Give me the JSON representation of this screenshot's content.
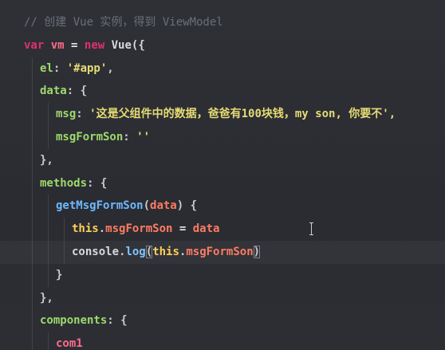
{
  "editor": {
    "lines": [
      {
        "indent": 0,
        "tokens": [
          {
            "t": "// 创建 Vue 实例，得到 ViewModel",
            "c": "comment"
          }
        ]
      },
      {
        "indent": 0,
        "tokens": [
          {
            "t": "var",
            "c": "keyword"
          },
          {
            "t": " ",
            "c": "plain"
          },
          {
            "t": "vm",
            "c": "var"
          },
          {
            "t": " = ",
            "c": "op"
          },
          {
            "t": "new",
            "c": "keyword"
          },
          {
            "t": " Vue({",
            "c": "plain"
          }
        ]
      },
      {
        "indent": 1,
        "tokens": [
          {
            "t": "el",
            "c": "prop"
          },
          {
            "t": ": ",
            "c": "punct"
          },
          {
            "t": "'#app'",
            "c": "string"
          },
          {
            "t": ",",
            "c": "punct"
          }
        ]
      },
      {
        "indent": 1,
        "tokens": [
          {
            "t": "data",
            "c": "prop"
          },
          {
            "t": ": {",
            "c": "punct"
          }
        ]
      },
      {
        "indent": 2,
        "tokens": [
          {
            "t": "msg",
            "c": "prop"
          },
          {
            "t": ": ",
            "c": "punct"
          },
          {
            "t": "'这是父组件中的数据，爸爸有100块钱，my son, 你要不',",
            "c": "string"
          }
        ]
      },
      {
        "indent": 2,
        "tokens": [
          {
            "t": "msgFormSon",
            "c": "prop"
          },
          {
            "t": ": ",
            "c": "punct"
          },
          {
            "t": "''",
            "c": "string"
          }
        ]
      },
      {
        "indent": 1,
        "tokens": [
          {
            "t": "},",
            "c": "punct"
          }
        ]
      },
      {
        "indent": 1,
        "tokens": [
          {
            "t": "methods",
            "c": "prop"
          },
          {
            "t": ": {",
            "c": "punct"
          }
        ]
      },
      {
        "indent": 2,
        "tokens": [
          {
            "t": "getMsgFormSon",
            "c": "fn"
          },
          {
            "t": "(",
            "c": "punct"
          },
          {
            "t": "data",
            "c": "param"
          },
          {
            "t": ") {",
            "c": "punct"
          }
        ]
      },
      {
        "indent": 3,
        "tokens": [
          {
            "t": "this",
            "c": "this"
          },
          {
            "t": ".",
            "c": "punct"
          },
          {
            "t": "msgFormSon",
            "c": "member"
          },
          {
            "t": " = ",
            "c": "op"
          },
          {
            "t": "data",
            "c": "param"
          }
        ]
      },
      {
        "indent": 3,
        "current": true,
        "tokens": [
          {
            "t": "console",
            "c": "plain"
          },
          {
            "t": ".",
            "c": "punct"
          },
          {
            "t": "log",
            "c": "log"
          },
          {
            "t": "(",
            "c": "punct",
            "box": true
          },
          {
            "t": "this",
            "c": "this"
          },
          {
            "t": ".",
            "c": "punct"
          },
          {
            "t": "msgFormSon",
            "c": "member"
          },
          {
            "t": ")",
            "c": "punct",
            "box": true
          }
        ]
      },
      {
        "indent": 2,
        "tokens": [
          {
            "t": "}",
            "c": "punct"
          }
        ]
      },
      {
        "indent": 1,
        "tokens": [
          {
            "t": "},",
            "c": "punct"
          }
        ]
      },
      {
        "indent": 1,
        "tokens": [
          {
            "t": "components",
            "c": "prop"
          },
          {
            "t": ": {",
            "c": "punct"
          }
        ]
      },
      {
        "indent": 2,
        "tokens": [
          {
            "t": "com1",
            "c": "comp"
          }
        ]
      }
    ]
  },
  "colors": {
    "background": "#2b2d33",
    "comment": "#6b6f78",
    "keyword": "#e0306e",
    "property": "#9ed96b",
    "string": "#e6db74",
    "function": "#6fb8ff",
    "parameter": "#ff7b62",
    "this": "#ffcf5a"
  },
  "icons": {
    "mouse_cursor": "text-cursor-icon"
  }
}
